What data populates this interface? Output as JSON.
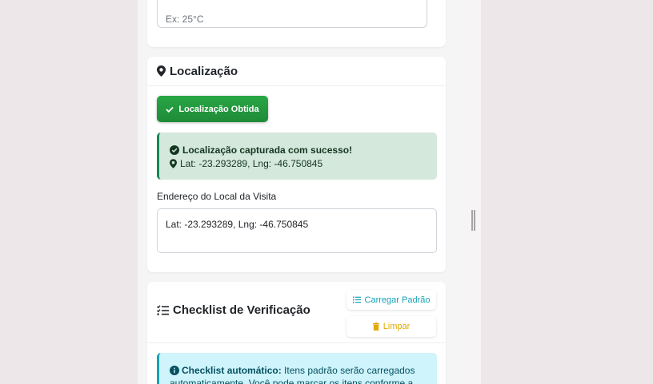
{
  "temperature": {
    "placeholder": "Ex: 25°C"
  },
  "location": {
    "title": "Localização",
    "button_label": "Localização Obtida",
    "alert_title": "Localização capturada com sucesso!",
    "alert_coords": "Lat: -23.293289, Lng: -46.750845",
    "address_label": "Endereço do Local da Visita",
    "address_value": "Lat: -23.293289, Lng: -46.750845"
  },
  "checklist": {
    "title": "Checklist de Verificação",
    "load_default_label": "Carregar Padrão",
    "clear_label": "Limpar",
    "info_strong": "Checklist automático:",
    "info_text": " Itens padrão serão carregados automaticamente. Você pode marcar os itens conforme a"
  },
  "colors": {
    "success": "#28a745",
    "info": "#17a2b8",
    "warning": "#e0a800"
  },
  "icons": {
    "location": "map-marker-icon",
    "check": "check-icon",
    "check_circle": "check-circle-icon",
    "checklist": "list-check-icon",
    "list": "list-icon",
    "trash": "trash-icon",
    "info": "info-circle-icon"
  }
}
